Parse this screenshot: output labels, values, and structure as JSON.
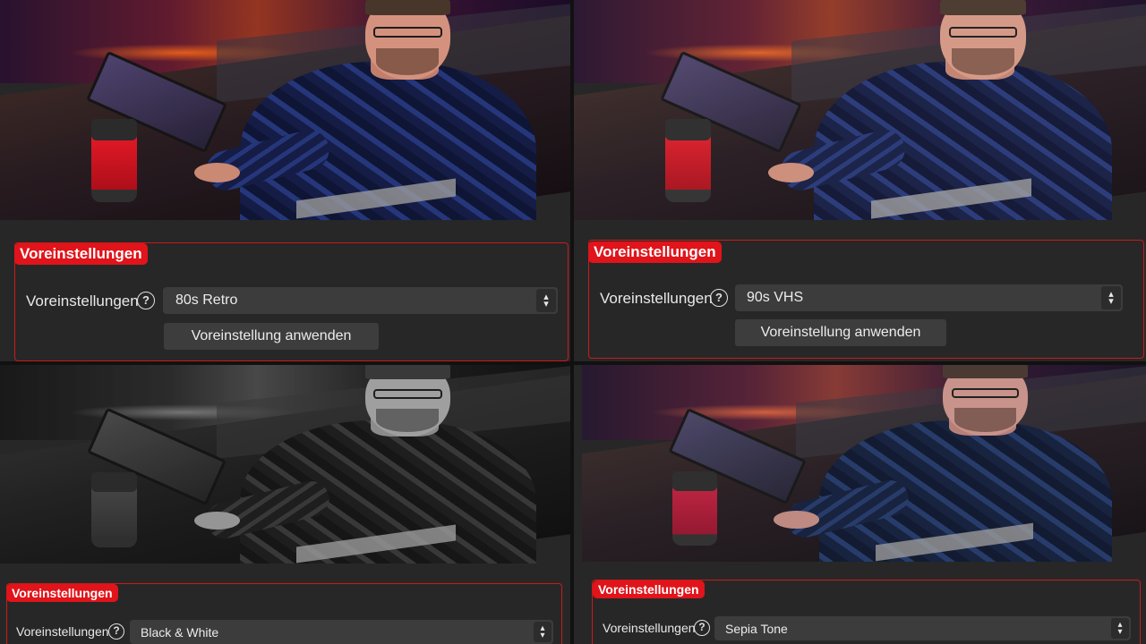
{
  "panels": [
    {
      "group_title": "Voreinstellungen",
      "row_label": "Voreinstellungen",
      "help_icon": "?",
      "selected_preset": "80s Retro",
      "apply_label": "Voreinstellung anwenden",
      "icon": "help-circle-icon"
    },
    {
      "group_title": "Voreinstellungen",
      "row_label": "Voreinstellungen",
      "help_icon": "?",
      "selected_preset": "90s VHS",
      "apply_label": "Voreinstellung anwenden",
      "icon": "help-circle-icon"
    },
    {
      "group_title": "Voreinstellungen",
      "row_label": "Voreinstellungen",
      "help_icon": "?",
      "selected_preset": "Black & White",
      "icon": "help-circle-icon"
    },
    {
      "group_title": "Voreinstellungen",
      "row_label": "Voreinstellungen",
      "help_icon": "?",
      "selected_preset": "Sepia Tone",
      "icon": "help-circle-icon"
    }
  ],
  "spinner": {
    "up": "▴",
    "down": "▾",
    "icon": "spinner-arrows-icon"
  },
  "colors": {
    "accent": "#e0141a",
    "border": "#cc1a1a",
    "panel_bg": "#272727",
    "field_bg": "#3c3c3c"
  }
}
